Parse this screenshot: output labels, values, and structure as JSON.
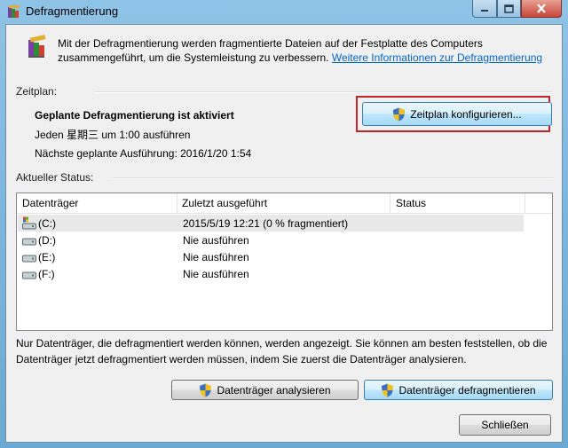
{
  "window": {
    "title": "Defragmentierung",
    "controls": {
      "minimize": "minimize",
      "maximize": "maximize",
      "close": "close"
    }
  },
  "intro": {
    "text": "Mit der Defragmentierung werden fragmentierte Dateien auf der Festplatte des Computers zusammengeführt, um die Systemleistung zu verbessern.",
    "link": "Weitere Informationen zur Defragmentierung"
  },
  "schedule": {
    "section_label": "Zeitplan:",
    "status": "Geplante Defragmentierung ist aktiviert",
    "run_line": "Jeden 星期三 um 1:00 ausführen",
    "next_run": "Nächste geplante Ausführung: 2016/1/20 1:54",
    "configure_button": "Zeitplan konfigurieren..."
  },
  "status": {
    "section_label": "Aktueller Status:",
    "columns": [
      "Datenträger",
      "Zuletzt ausgeführt",
      "Status"
    ],
    "drives": [
      {
        "name": "(C:)",
        "last_run": "2015/5/19 12:21 (0 % fragmentiert)",
        "status": "",
        "icon": "system-drive-icon"
      },
      {
        "name": "(D:)",
        "last_run": "Nie ausführen",
        "status": "",
        "icon": "drive-icon"
      },
      {
        "name": "(E:)",
        "last_run": "Nie ausführen",
        "status": "",
        "icon": "drive-icon"
      },
      {
        "name": "(F:)",
        "last_run": "Nie ausführen",
        "status": "",
        "icon": "drive-icon"
      }
    ]
  },
  "footnote": "Nur Datenträger, die defragmentiert werden können, werden angezeigt. Sie können am besten feststellen, ob die Datenträger jetzt defragmentiert werden müssen, indem Sie zuerst die Datenträger analysieren.",
  "actions": {
    "analyze": "Datenträger analysieren",
    "defragment": "Datenträger defragmentieren",
    "close": "Schließen"
  },
  "colors": {
    "accent": "#0066cc",
    "highlight": "#c0262a",
    "title_bar": "#8fc3e6"
  }
}
